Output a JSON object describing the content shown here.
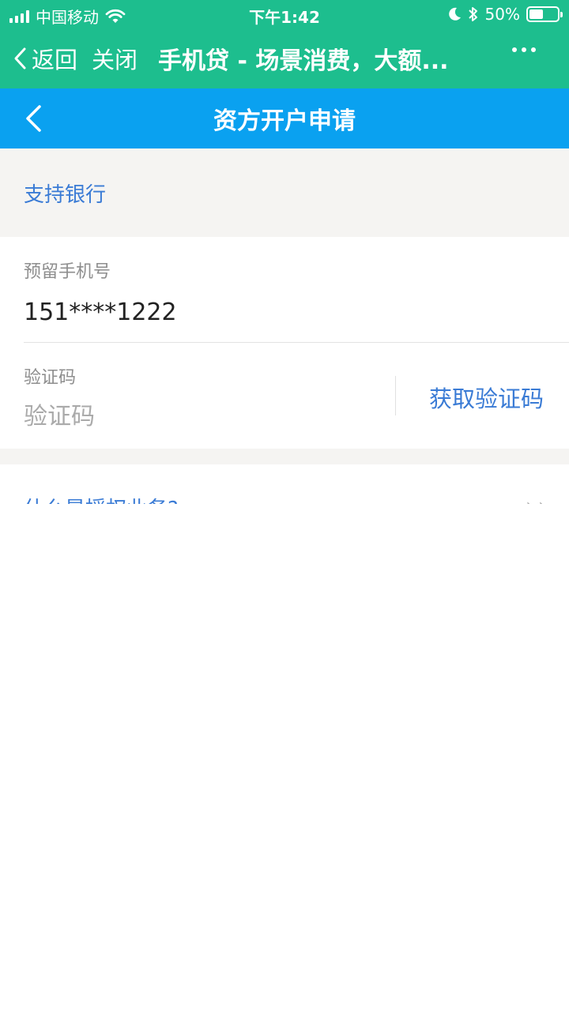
{
  "status_bar": {
    "carrier": "中国移动",
    "time": "下午1:42",
    "battery": "50%",
    "battery_level": 0.5
  },
  "nav": {
    "back_label": "返回",
    "close_label": "关闭",
    "title": "手机贷 - 场景消费，大额..."
  },
  "header": {
    "title": "资方开户申请"
  },
  "banks": {
    "label": "支持银行"
  },
  "form": {
    "phone_label": "预留手机号",
    "phone_value": "151****1222",
    "code_label": "验证码",
    "code_placeholder": "验证码",
    "code_button": "获取验证码"
  },
  "faq": {
    "link": "什么是授权业务?",
    "arrow": "› ›"
  },
  "colors": {
    "nav_green": "#1dbe8e",
    "header_blue": "#0aa1f0",
    "link_blue": "#3a7bd5",
    "gray_bg": "#f5f4f2"
  },
  "icons": [
    "signal-icon",
    "wifi-icon",
    "moon-icon",
    "bluetooth-icon",
    "battery-icon",
    "chevron-left-icon",
    "more-icon"
  ]
}
